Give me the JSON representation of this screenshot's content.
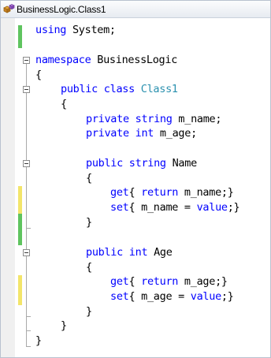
{
  "navigation": {
    "type_combo": "BusinessLogic.Class1",
    "class_icon": "class-icon"
  },
  "code": {
    "line1": {
      "kw": "using",
      "rest": " System;"
    },
    "line3": {
      "kw": "namespace",
      "rest": " BusinessLogic"
    },
    "line4": {
      "text": "{"
    },
    "line5": {
      "kw1": "public",
      "kw2": "class",
      "type": "Class1"
    },
    "line6": {
      "text": "{"
    },
    "line7": {
      "kw1": "private",
      "kw2": "string",
      "rest": " m_name;"
    },
    "line8": {
      "kw1": "private",
      "kw2": "int",
      "rest": " m_age;"
    },
    "line10": {
      "kw1": "public",
      "kw2": "string",
      "rest": " Name"
    },
    "line11": {
      "text": "{"
    },
    "line12": {
      "kw1": "get",
      "a": "{ ",
      "kw2": "return",
      "rest": " m_name;}"
    },
    "line13": {
      "kw1": "set",
      "a": "{ m_name = ",
      "kw2": "value",
      "rest": ";}"
    },
    "line14": {
      "text": "}"
    },
    "line16": {
      "kw1": "public",
      "kw2": "int",
      "rest": " Age"
    },
    "line17": {
      "text": "{"
    },
    "line18": {
      "kw1": "get",
      "a": "{ ",
      "kw2": "return",
      "rest": " m_age;}"
    },
    "line19": {
      "kw1": "set",
      "a": "{ m_age = ",
      "kw2": "value",
      "rest": ";}"
    },
    "line20": {
      "text": "}"
    },
    "line21": {
      "text": "}"
    },
    "line22": {
      "text": "}"
    }
  },
  "colors": {
    "keyword": "#0000ff",
    "type": "#2b91af",
    "saved_change": "#5fc45f",
    "unsaved_change": "#f3e56a"
  }
}
